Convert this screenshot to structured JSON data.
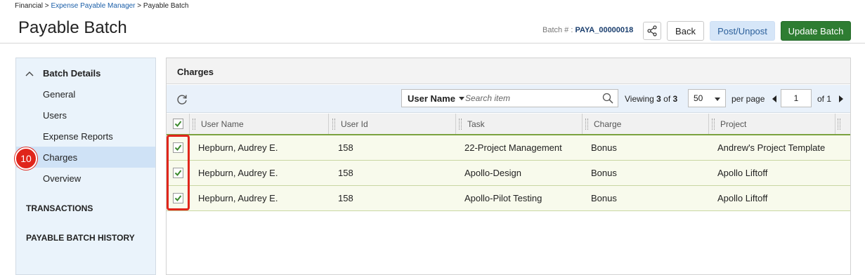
{
  "breadcrumb": {
    "part1": "Financial",
    "sep1": " > ",
    "link": "Expense Payable Manager",
    "sep2": " > ",
    "part3": "Payable Batch"
  },
  "page": {
    "title": "Payable Batch"
  },
  "batch": {
    "label": "Batch # : ",
    "number": "PAYA_00000018"
  },
  "buttons": {
    "back": "Back",
    "post": "Post/Unpost",
    "update": "Update Batch"
  },
  "sidebar": {
    "section_title": "Batch Details",
    "items": [
      {
        "label": "General"
      },
      {
        "label": "Users"
      },
      {
        "label": "Expense Reports"
      },
      {
        "label": "Charges"
      },
      {
        "label": "Overview"
      }
    ],
    "transactions": "TRANSACTIONS",
    "history": "PAYABLE BATCH HISTORY"
  },
  "step_badge": "10",
  "panel": {
    "title": "Charges"
  },
  "toolbar": {
    "filter": "User Name",
    "search_placeholder": "Search item",
    "viewing_prefix": "Viewing ",
    "viewing_count": "3",
    "viewing_mid": " of ",
    "viewing_total": "3",
    "per_page_value": "50",
    "per_page_label": "per page",
    "page_value": "1",
    "page_of": "of 1"
  },
  "grid": {
    "columns": [
      "User Name",
      "User Id",
      "Task",
      "Charge",
      "Project"
    ],
    "rows": [
      {
        "user_name": "Hepburn, Audrey E.",
        "user_id": "158",
        "task": "22-Project Management",
        "charge": "Bonus",
        "project": "Andrew's Project Template"
      },
      {
        "user_name": "Hepburn, Audrey E.",
        "user_id": "158",
        "task": "Apollo-Design",
        "charge": "Bonus",
        "project": "Apollo Liftoff"
      },
      {
        "user_name": "Hepburn, Audrey E.",
        "user_id": "158",
        "task": "Apollo-Pilot Testing",
        "charge": "Bonus",
        "project": "Apollo Liftoff"
      }
    ]
  },
  "colors": {
    "accent_green": "#2e7d32",
    "highlight_red": "#e0251b",
    "link_blue": "#1a5ea8"
  },
  "icons": {
    "share": "share-icon",
    "refresh": "refresh-icon",
    "search": "search-icon",
    "collapse": "chevron-up-icon",
    "check": "check-icon"
  }
}
